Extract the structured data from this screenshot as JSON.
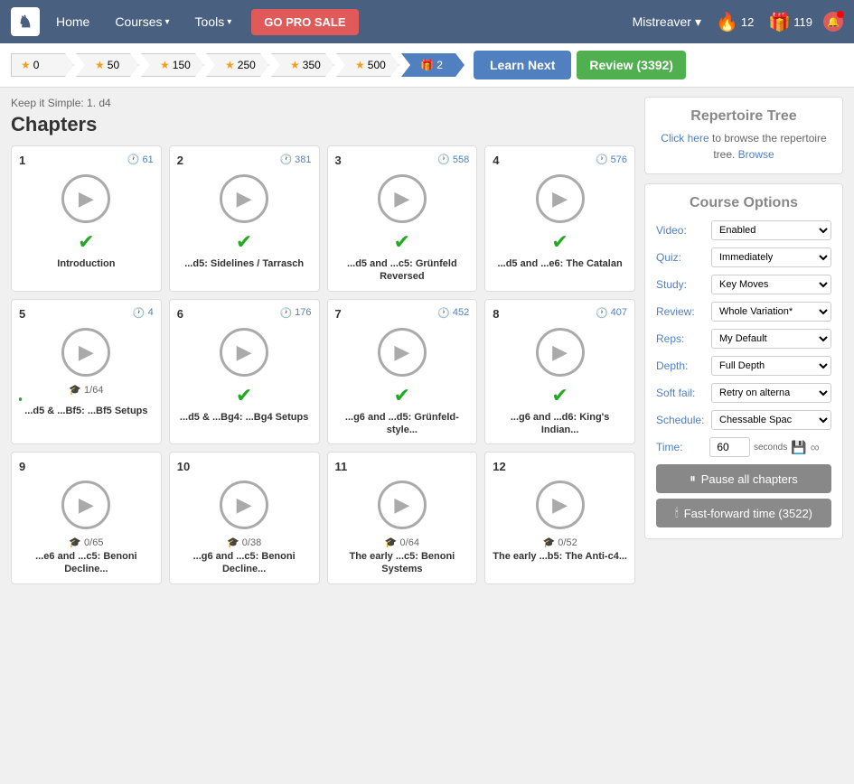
{
  "nav": {
    "logo": "♞",
    "home_label": "Home",
    "courses_label": "Courses",
    "tools_label": "Tools",
    "go_pro_label": "GO PRO SALE",
    "user_label": "Mistreaver",
    "flame_count": "12",
    "gift_count": "119",
    "notif_count": "1"
  },
  "progress": {
    "steps": [
      {
        "label": "0",
        "active": false
      },
      {
        "label": "50",
        "active": false
      },
      {
        "label": "150",
        "active": false
      },
      {
        "label": "250",
        "active": false
      },
      {
        "label": "350",
        "active": false
      },
      {
        "label": "500",
        "active": false
      },
      {
        "label": "2",
        "active": true,
        "is_gift": true
      }
    ],
    "learn_next_label": "Learn Next",
    "review_label": "Review (3392)"
  },
  "breadcrumb": "Keep it Simple: 1. d4",
  "chapters_title": "Chapters",
  "chapters": [
    {
      "num": "1",
      "count": "61",
      "completed": true,
      "label": "Introduction",
      "study_info": null,
      "progress_pct": 100
    },
    {
      "num": "2",
      "count": "381",
      "completed": true,
      "label": "...d5: Sidelines / Tarrasch",
      "study_info": null,
      "progress_pct": 100
    },
    {
      "num": "3",
      "count": "558",
      "completed": true,
      "label": "...d5 and ...c5: Grünfeld Reversed",
      "study_info": null,
      "progress_pct": 100
    },
    {
      "num": "4",
      "count": "576",
      "completed": true,
      "label": "...d5 and ...e6: The Catalan",
      "study_info": null,
      "progress_pct": 100
    },
    {
      "num": "5",
      "count": "4",
      "completed": false,
      "label": "...d5 & ...Bf5: ...Bf5 Setups",
      "study_info": "🎓 1/64",
      "progress_pct": 2
    },
    {
      "num": "6",
      "count": "176",
      "completed": true,
      "label": "...d5 & ...Bg4: ...Bg4 Setups",
      "study_info": null,
      "progress_pct": 100
    },
    {
      "num": "7",
      "count": "452",
      "completed": true,
      "label": "...g6 and ...d5: Grünfeld-style...",
      "study_info": null,
      "progress_pct": 100
    },
    {
      "num": "8",
      "count": "407",
      "completed": true,
      "label": "...g6 and ...d6: King's Indian...",
      "study_info": null,
      "progress_pct": 100
    },
    {
      "num": "9",
      "count": null,
      "completed": false,
      "label": "...e6 and ...c5: Benoni Decline...",
      "study_info": "🎓 0/65",
      "progress_pct": 0
    },
    {
      "num": "10",
      "count": null,
      "completed": false,
      "label": "...g6 and ...c5: Benoni Decline...",
      "study_info": "🎓 0/38",
      "progress_pct": 0
    },
    {
      "num": "11",
      "count": null,
      "completed": false,
      "label": "The early ...c5: Benoni Systems",
      "study_info": "🎓 0/64",
      "progress_pct": 0
    },
    {
      "num": "12",
      "count": null,
      "completed": false,
      "label": "The early ...b5: The Anti-c4...",
      "study_info": "🎓 0/52",
      "progress_pct": 0
    }
  ],
  "right_panel": {
    "rep_tree_title": "Repertoire Tree",
    "rep_tree_text": " to browse the repertoire tree.",
    "rep_tree_link": "Click here",
    "rep_tree_browse": "Browse",
    "course_options_title": "Course Options",
    "options": [
      {
        "label": "Video:",
        "value": "Enabled",
        "id": "video"
      },
      {
        "label": "Quiz:",
        "value": "Immediately",
        "id": "quiz"
      },
      {
        "label": "Study:",
        "value": "Key Moves",
        "id": "study"
      },
      {
        "label": "Review:",
        "value": "Whole Variation*",
        "id": "review"
      },
      {
        "label": "Reps:",
        "value": "My Default",
        "id": "reps"
      },
      {
        "label": "Depth:",
        "value": "Full Depth",
        "id": "depth"
      },
      {
        "label": "Soft fail:",
        "value": "Retry on alterna",
        "id": "softfail"
      },
      {
        "label": "Schedule:",
        "value": "Chessable Spac",
        "id": "schedule"
      }
    ],
    "time_label": "Time:",
    "time_value": "60",
    "time_unit": "seconds",
    "pause_label": "Pause all chapters",
    "ff_label": "Fast-forward time (3522)"
  }
}
